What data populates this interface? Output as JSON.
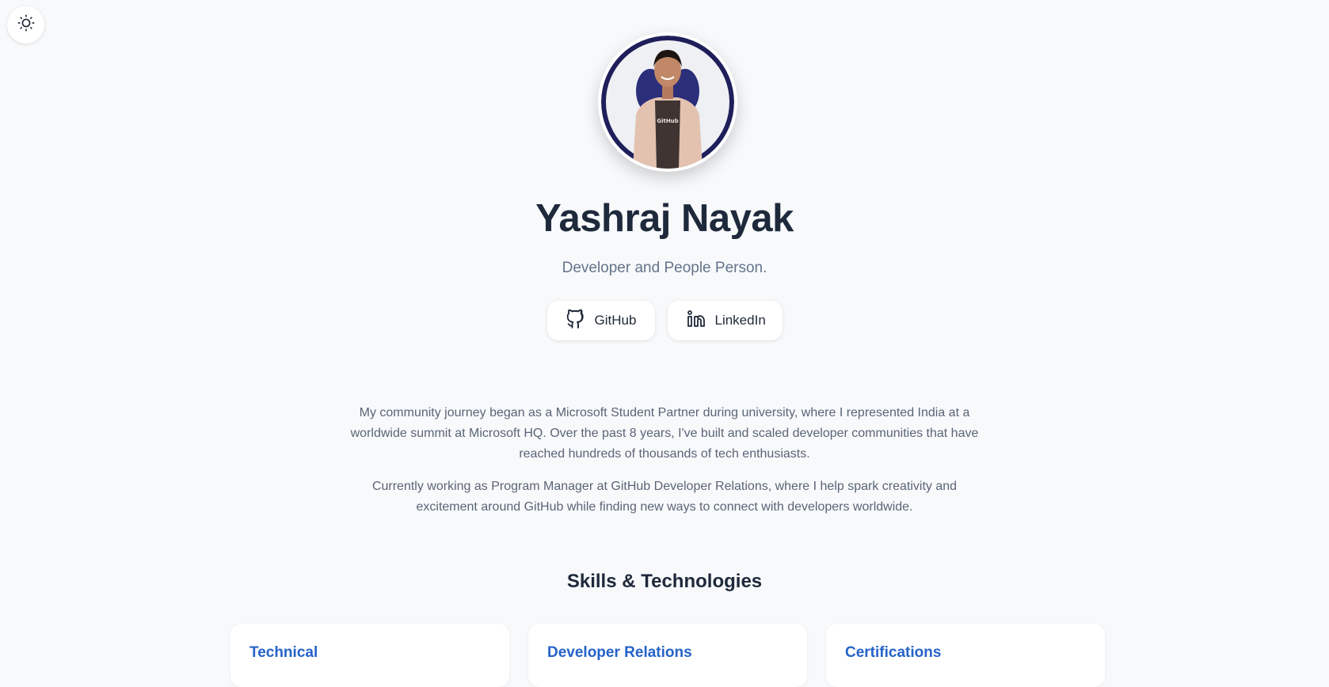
{
  "theme_toggle": {
    "icon": "sun-icon"
  },
  "profile": {
    "avatar_alt": "Yashraj Nayak",
    "name": "Yashraj Nayak",
    "tagline": "Developer and People Person."
  },
  "social": [
    {
      "label": "GitHub",
      "icon": "github-icon"
    },
    {
      "label": "LinkedIn",
      "icon": "linkedin-icon"
    }
  ],
  "bio": {
    "paragraph_1": "My community journey began as a Microsoft Student Partner during university, where I represented India at a worldwide summit at Microsoft HQ. Over the past 8 years, I've built and scaled developer communities that have reached hundreds of thousands of tech enthusiasts.",
    "paragraph_2": "Currently working as Program Manager at GitHub Developer Relations, where I help spark creativity and excitement around GitHub while finding new ways to connect with developers worldwide."
  },
  "skills": {
    "title": "Skills & Technologies",
    "cards": [
      {
        "title": "Technical"
      },
      {
        "title": "Developer Relations"
      },
      {
        "title": "Certifications"
      }
    ]
  },
  "colors": {
    "background": "#f7f9fb",
    "heading": "#1e293b",
    "muted_text": "#64748b",
    "accent_blue": "#2563c9",
    "avatar_ring": "#1e1f5a"
  }
}
